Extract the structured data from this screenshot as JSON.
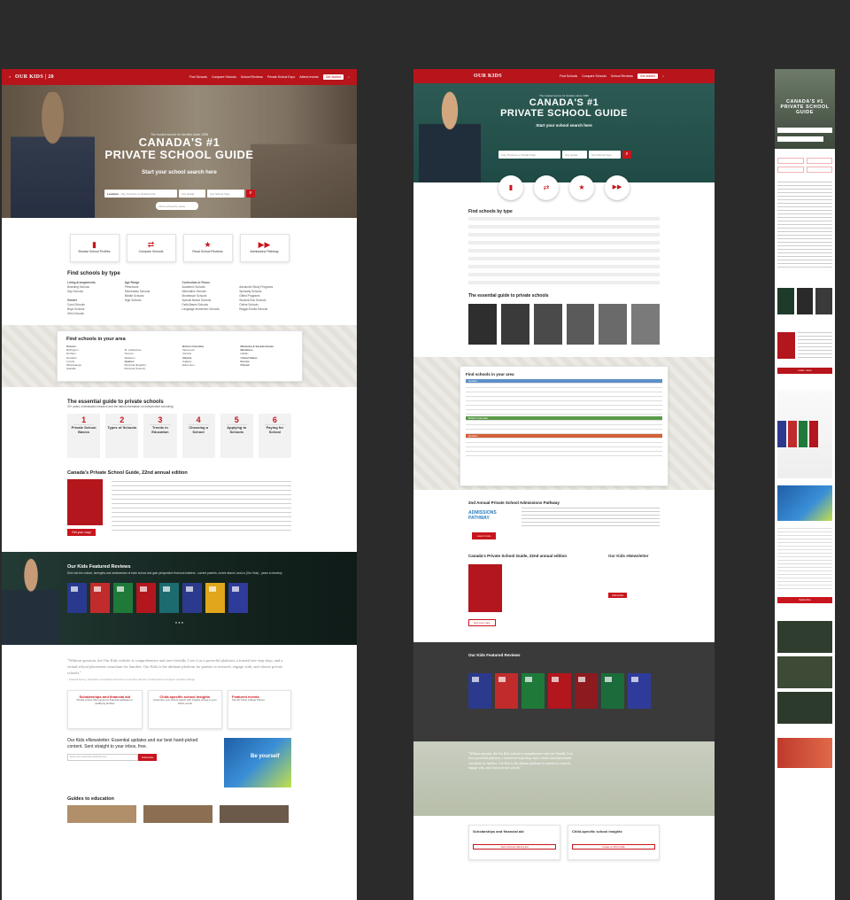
{
  "brand": {
    "logo": "OUR KIDS",
    "logo_years": "20",
    "accent": "#b8141c"
  },
  "nav": {
    "links": [
      "Find Schools",
      "Compare Schools",
      "School Reviews",
      "Private School Expo",
      "Attend events"
    ],
    "cta": "Get started"
  },
  "hero": {
    "tagline": "The trusted source for families since 1998",
    "title_line1": "CANADA'S #1",
    "title_line2": "PRIVATE SCHOOL GUIDE",
    "search_heading": "Start your school search here",
    "location_label": "Location:",
    "location_placeholder": "City, Province or Postal Code",
    "grade_placeholder": "Any Grade",
    "type_placeholder": "Any School Type",
    "find_by_name": "Find a school by name"
  },
  "quick_links": [
    "Browse School Profiles",
    "Compare Schools",
    "Read School Reviews",
    "Admissions Pathway"
  ],
  "find_by_type": {
    "title": "Find schools by type",
    "columns": [
      {
        "heading": "Living Arrangements",
        "items": [
          "Boarding Schools",
          "Day Schools"
        ],
        "heading2": "Gender",
        "items2": [
          "Coed Schools",
          "Boys Schools",
          "Girls Schools"
        ]
      },
      {
        "heading": "Age Range",
        "items": [
          "Preschools",
          "Elementary Schools",
          "Middle Schools",
          "High Schools"
        ]
      },
      {
        "heading": "Curriculum or Focus",
        "items": [
          "Academic Schools",
          "Alternative Schools",
          "Montessori Schools",
          "Special Needs Schools",
          "Faith-Based Schools",
          "Language Immersion Schools"
        ]
      },
      {
        "heading": "",
        "items": [
          "Advanced Study Programs",
          "Specialty Schools",
          "Gifted Programs",
          "Student-Run Schools",
          "Online Schools",
          "Reggio Emilia Schools"
        ]
      }
    ]
  },
  "find_by_area": {
    "title": "Find schools in your area",
    "columns": [
      {
        "heading": "Ontario",
        "items": [
          "Burlington",
          "Durham",
          "Hamilton",
          "Lorette",
          "Mississauga",
          "Oakville"
        ]
      },
      {
        "heading": "",
        "items": [
          "St. Catharines",
          "Toronto",
          "Waterloo",
          "Quebec",
          "Montreal (English)",
          "Montreal (French)"
        ]
      },
      {
        "heading": "British Columbia",
        "items": [
          "Vancouver",
          "Victoria",
          "Alberta",
          "Calgary",
          "Edmonton"
        ]
      },
      {
        "heading": "Manitoba & Saskatchewan",
        "items": [
          "Maritimes",
          "Halifax",
          "United States",
          "Europe",
          "Poland"
        ]
      }
    ]
  },
  "guide": {
    "title": "The essential guide to private schools",
    "subtitle": "20+ years of dedicated research and the latest information on independent schooling",
    "steps": [
      {
        "num": "1",
        "label": "Private School Basics"
      },
      {
        "num": "2",
        "label": "Types of Schools"
      },
      {
        "num": "3",
        "label": "Trends in Education"
      },
      {
        "num": "4",
        "label": "Choosing a School"
      },
      {
        "num": "5",
        "label": "Applying to Schools"
      },
      {
        "num": "6",
        "label": "Paying for School"
      }
    ]
  },
  "edition": {
    "title": "Canada's Private School Guide, 22nd annual edition",
    "cta": "Get your copy"
  },
  "reviews": {
    "title": "Our Kids Featured Reviews",
    "text": "Dive into the culture, strengths and weaknesses of each school and gain perspective that took insiders - current parents, recent alumni, and us (Our Kids) - years to develop"
  },
  "quote": {
    "text": "\"Without question, the Our Kids website is comprehensive and user-friendly. I see it as a powerful platform, a trusted one-stop shop, and a virtual school placement consultant for families. Our Kids is the ultimate platform for parents to research, engage with, and choose private schools.\"",
    "attribution": "- Chantal Kenny, education consultant and former executive director of admissions at Upper Canada College"
  },
  "bottom_cards": [
    {
      "title": "Scholarships and financial aid",
      "text": "Private school offer generous financial packages to qualifying families"
    },
    {
      "title": "Child-specific school insights",
      "text": "Customize your school search with insights unique to your child's needs"
    },
    {
      "title": "Featured events",
      "text": "Feb 26 Trinity College School"
    }
  ],
  "newsletter": {
    "title": "Our Kids eNewsletter: Essential updates and our best hand-picked content. Sent straight to your inbox, free.",
    "placeholder": "Enter your email and subscribe here",
    "cta": "Subscribe",
    "promo": "Be yourself"
  },
  "guides_edu": {
    "title": "Guides to education"
  },
  "v2": {
    "pathway_title": "2nd Annual Private School Admissions Pathway",
    "pathway_badge": "ADMISSIONS PATHWAY",
    "pathway_cta": "Learn more",
    "newsletter_title": "Our Kids eNewsletter",
    "regions": [
      "Ontario",
      "British Columbia",
      "Quebec"
    ],
    "view_schools_cta": "View schools offering aid",
    "child_profile_cta": "Create a child profile"
  },
  "v3": {
    "title_line1": "CANADA'S #1",
    "title_line2": "PRIVATE SCHOOL GUIDE",
    "learn_more": "Learn more"
  }
}
